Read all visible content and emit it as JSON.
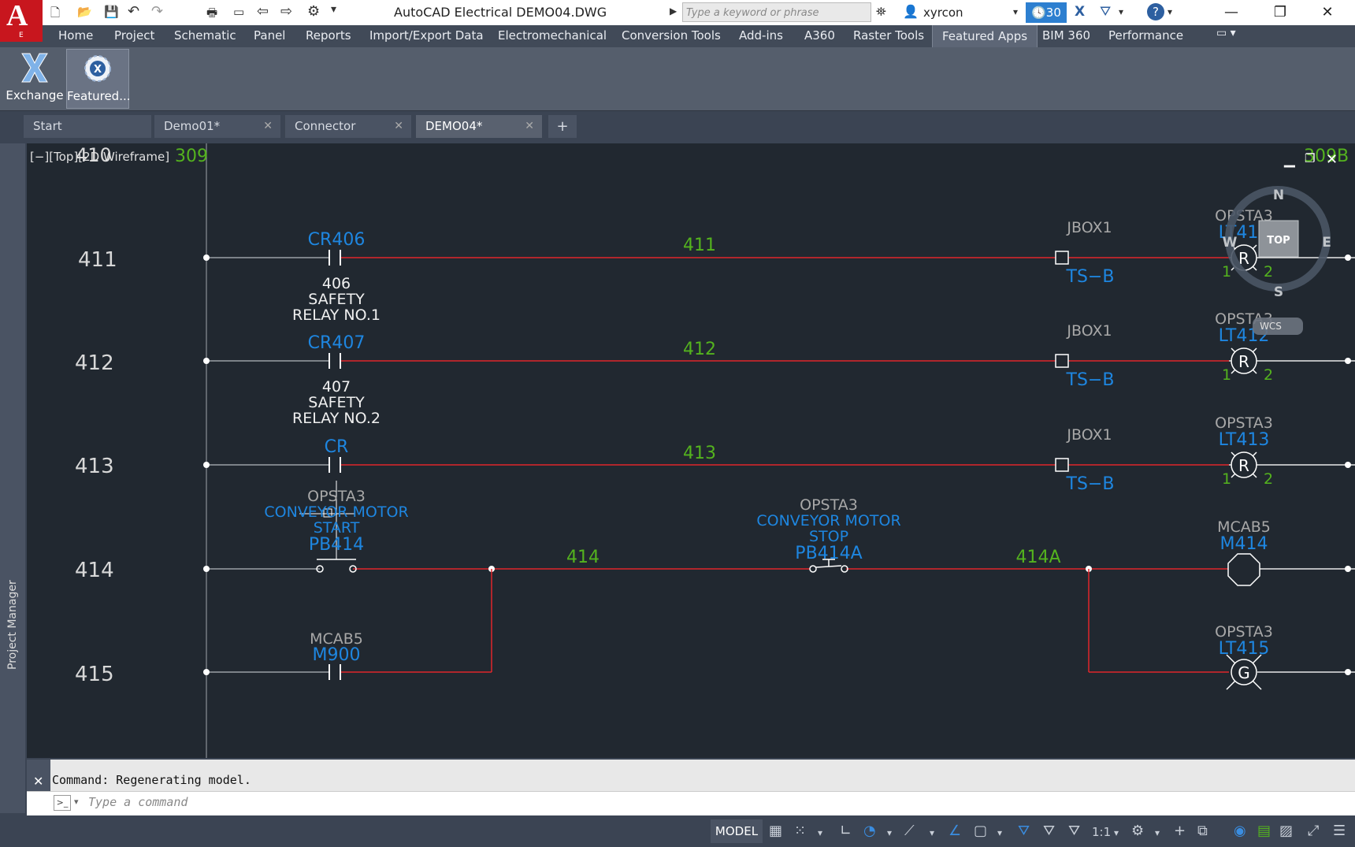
{
  "app": {
    "logo_letter": "A",
    "logo_sub": "E",
    "title": "AutoCAD Electrical    DEMO04.DWG",
    "search_placeholder": "Type a keyword or phrase",
    "user": "xyrcon",
    "timer": "30",
    "accent": "#c8161e"
  },
  "ribbon": {
    "tabs": [
      "Home",
      "Project",
      "Schematic",
      "Panel",
      "Reports",
      "Import/Export Data",
      "Electromechanical",
      "Conversion Tools",
      "Add-ins",
      "A360",
      "Raster Tools",
      "Featured Apps",
      "BIM 360",
      "Performance"
    ],
    "active_tab": "Featured Apps",
    "buttons": [
      {
        "label": "Exchange",
        "icon": "exchange-icon"
      },
      {
        "label": "Featured...",
        "icon": "featured-apps-icon"
      }
    ]
  },
  "file_tabs": [
    {
      "label": "Start",
      "closable": false
    },
    {
      "label": "Demo01*",
      "closable": true
    },
    {
      "label": "Connector",
      "closable": true
    },
    {
      "label": "DEMO04*",
      "closable": true,
      "active": true
    }
  ],
  "viewport": {
    "label": "[−][Top][2D Wireframe]",
    "viewcube": {
      "n": "N",
      "s": "S",
      "e": "E",
      "w": "W",
      "face": "TOP",
      "ucs": "WCS"
    }
  },
  "schematic": {
    "top_partial": {
      "rung": "410",
      "ref": "309",
      "ref_right": "309B"
    },
    "rungs": [
      {
        "num": "411",
        "tag": "CR406",
        "desc": [
          "406",
          "SAFETY",
          "RELAY NO.1"
        ],
        "wire": "411",
        "jbox": "JBOX1",
        "terminal": "TS−B",
        "lamp_loc": "OPSTA3",
        "lamp_tag": "LT411",
        "lamp_letter": "R",
        "pin1": "1",
        "pin2": "2"
      },
      {
        "num": "412",
        "tag": "CR407",
        "desc": [
          "407",
          "SAFETY",
          "RELAY NO.2"
        ],
        "wire": "412",
        "jbox": "JBOX1",
        "terminal": "TS−B",
        "lamp_loc": "OPSTA3",
        "lamp_tag": "LT412",
        "lamp_letter": "R",
        "pin1": "1",
        "pin2": "2"
      },
      {
        "num": "413",
        "tag": "CR",
        "wire": "413",
        "jbox": "JBOX1",
        "terminal": "TS−B",
        "lamp_loc": "OPSTA3",
        "lamp_tag": "LT413",
        "lamp_letter": "R",
        "pin1": "1",
        "pin2": "2"
      },
      {
        "num": "414",
        "start_loc": "OPSTA3",
        "start_desc": [
          "CONVEYOR MOTOR",
          "START"
        ],
        "start_tag": "PB414",
        "wire_a": "414",
        "stop_loc": "OPSTA3",
        "stop_desc": [
          "CONVEYOR MOTOR",
          "STOP"
        ],
        "stop_tag": "PB414A",
        "wire_b": "414A",
        "motor_loc": "MCAB5",
        "motor_tag": "M414"
      },
      {
        "num": "415",
        "contact_loc": "MCAB5",
        "contact_tag": "M900",
        "lamp_loc": "OPSTA3",
        "lamp_tag": "LT415",
        "lamp_letter": "G"
      }
    ]
  },
  "command": {
    "history": "Command: Regenerating model.",
    "placeholder": "Type a command"
  },
  "status": {
    "model": "MODEL",
    "scale": "1:1"
  },
  "side_panel": {
    "label": "Project Manager"
  }
}
